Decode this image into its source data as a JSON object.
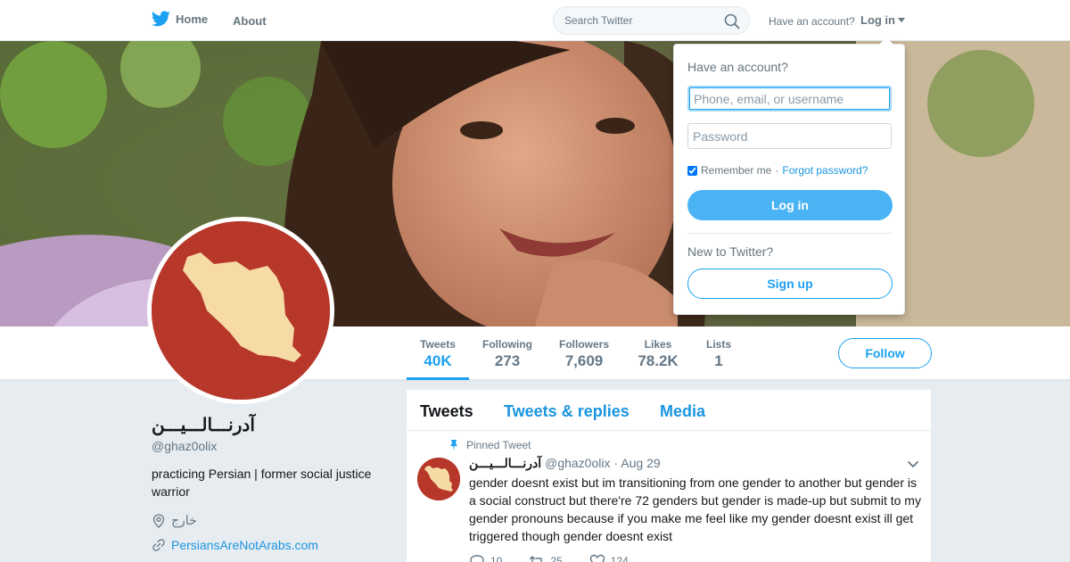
{
  "nav": {
    "home_label": "Home",
    "about_label": "About",
    "search_placeholder": "Search Twitter",
    "have_account": "Have an account?",
    "login_label": "Log in",
    "brand_color": "#1da1f2"
  },
  "login_dropdown": {
    "title": "Have an account?",
    "username_placeholder": "Phone, email, or username",
    "password_placeholder": "Password",
    "remember_me": "Remember me",
    "separator": "·",
    "forgot_password": "Forgot password?",
    "login_button": "Log in",
    "new_to_twitter": "New to Twitter?",
    "signup_button": "Sign up"
  },
  "profile": {
    "name": "آدرنـــالـــيـــن",
    "handle": "@ghaz0olix",
    "bio": "practicing Persian | former social justice warrior",
    "location": "خارج",
    "url": "PersiansAreNotArabs.com",
    "avatar_color": "#b7382a"
  },
  "stats": [
    {
      "label": "Tweets",
      "value": "40K",
      "active": true
    },
    {
      "label": "Following",
      "value": "273"
    },
    {
      "label": "Followers",
      "value": "7,609"
    },
    {
      "label": "Likes",
      "value": "78.2K"
    },
    {
      "label": "Lists",
      "value": "1"
    }
  ],
  "follow_button": "Follow",
  "timeline": {
    "tabs": [
      "Tweets",
      "Tweets & replies",
      "Media"
    ],
    "pinned_label": "Pinned Tweet",
    "tweet": {
      "name": "آدرنـــالـــيـــن",
      "handle": "@ghaz0olix",
      "time": "· Aug 29",
      "text": "gender doesnt exist but im transitioning from one gender to another but gender is a social construct but there're 72 genders but gender is made-up but submit to my gender pronouns because if you make me feel like my gender doesnt exist ill get triggered though gender doesnt exist",
      "replies": "10",
      "retweets": "25",
      "likes": "124"
    }
  }
}
